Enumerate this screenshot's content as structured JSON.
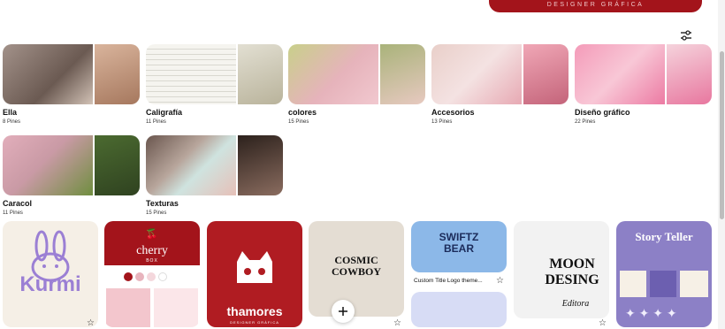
{
  "banner": {
    "text": "DESIGNER GRÁFICA"
  },
  "boards": [
    {
      "title": "Ella",
      "count": "8 Pines",
      "colors": [
        "#8a7468",
        "#c9a58d",
        "#4a3b35"
      ]
    },
    {
      "title": "Caligrafía",
      "count": "11 Pines",
      "colors": [
        "#f2f1ec",
        "#dcdbd2",
        "#c8c3b0"
      ]
    },
    {
      "title": "colores",
      "count": "15 Pines",
      "colors": [
        "#b6c07a",
        "#e9b0b8",
        "#8fa168"
      ]
    },
    {
      "title": "Accesorios",
      "count": "13 Pines",
      "colors": [
        "#e6c7c4",
        "#f1dcdc",
        "#d27b8c"
      ]
    },
    {
      "title": "Diseño gráfico",
      "count": "22 Pines",
      "colors": [
        "#f29ab7",
        "#f7c3d3",
        "#e76d9a"
      ]
    },
    {
      "title": "Caracol",
      "count": "11 Pines",
      "colors": [
        "#d8a2b0",
        "#6b8b3a",
        "#3f5a2a"
      ]
    },
    {
      "title": "Texturas",
      "count": "15 Pines",
      "colors": [
        "#5a4a44",
        "#cfe0dd",
        "#3a2c26"
      ]
    }
  ],
  "pins": [
    {
      "name": "kurmi",
      "text": "Kurmi",
      "bg": "#f5efe6",
      "fg": "#9b7fd4"
    },
    {
      "name": "cherry",
      "text": "cherry",
      "sub": "BOX",
      "bg": "#a3141b",
      "fg": "#ffffff"
    },
    {
      "name": "thamores",
      "text": "thamores",
      "sub": "DESIGNER GRÁFICA",
      "bg": "#b01c22",
      "fg": "#ffffff"
    },
    {
      "name": "cosmic-cowboy",
      "text": "COSMIC COWBOY",
      "bg": "#e4ddd3",
      "fg": "#111111"
    },
    {
      "name": "swiftz-bear",
      "text": "SWIFTZ BEAR",
      "caption": "Custom Title Logo theme...",
      "bg": "#8cb8e8",
      "fg": "#1b2b5a"
    },
    {
      "name": "moon-desing",
      "text": "MOON DESING",
      "sub": "Editora",
      "bg": "#f2f2f2",
      "fg": "#111111"
    },
    {
      "name": "story-teller",
      "text": "Story Teller",
      "bg": "#8c80c6",
      "fg": "#ffffff"
    }
  ]
}
